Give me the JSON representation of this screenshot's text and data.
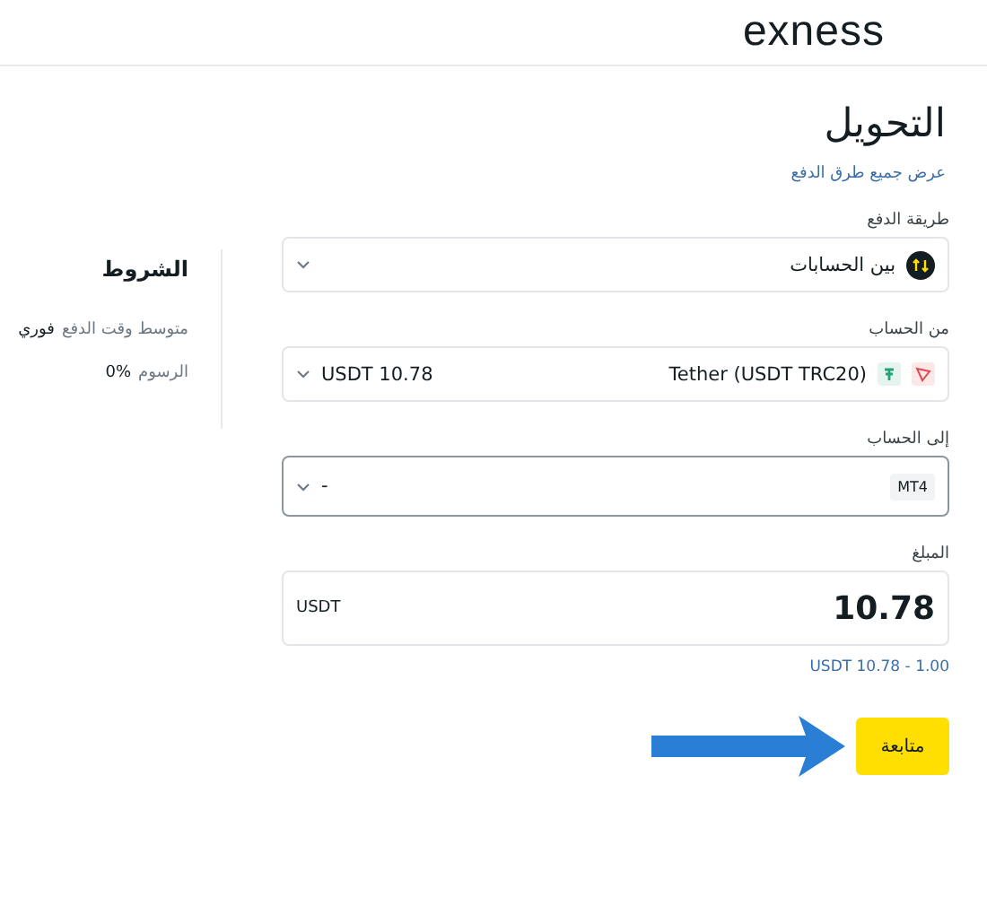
{
  "header": {
    "logo": "exness"
  },
  "title": "التحويل",
  "link": "عرض جميع طرق الدفع",
  "sidebar": {
    "title": "الشروط",
    "rows": [
      {
        "label": "متوسط وقت الدفع",
        "value": "فوري"
      },
      {
        "label": "الرسوم",
        "value": "0%"
      }
    ]
  },
  "fields": [
    {
      "kind": "method",
      "label": "طريقة الدفع",
      "value": "بين الحسابات",
      "focused": false
    },
    {
      "kind": "wallet",
      "label": "من الحساب",
      "value": "Tether (USDT TRC20)",
      "balance": "USDT 10.78",
      "focused": false
    },
    {
      "kind": "account",
      "label": "إلى الحساب",
      "badge": "MT4",
      "value": "-",
      "focused": true
    }
  ],
  "amount": {
    "label": "المبلغ",
    "value": "10.78",
    "currency": "USDT",
    "hint": "USDT 10.78 - 1.00"
  },
  "button": "متابعة"
}
